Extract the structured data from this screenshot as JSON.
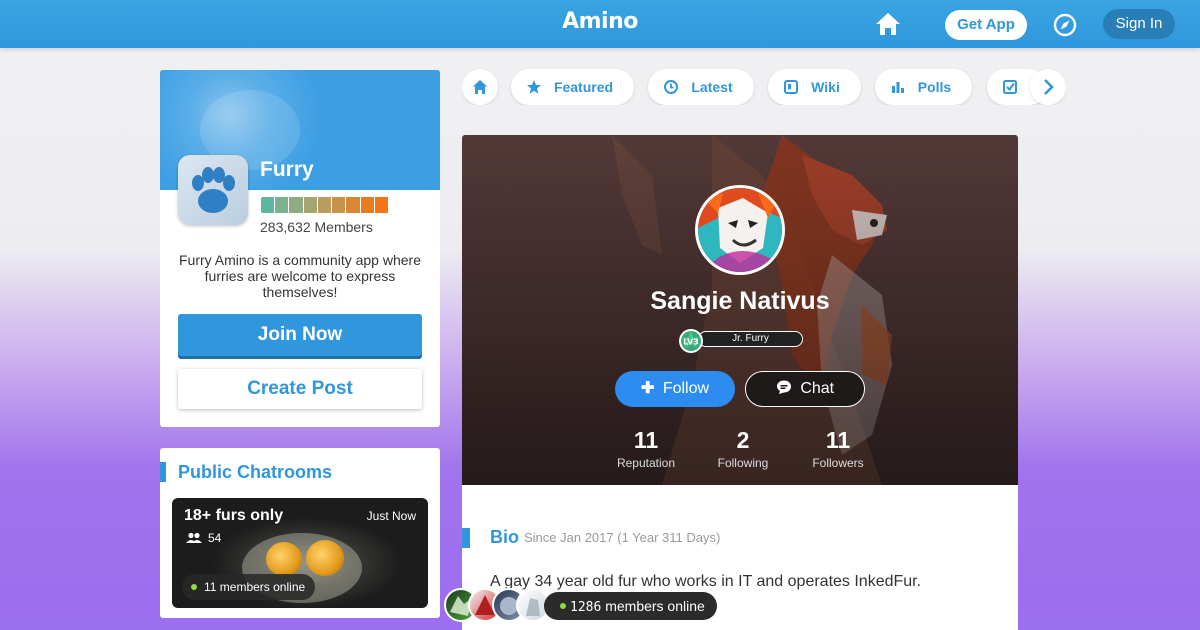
{
  "header": {
    "logo_text": "Amino",
    "get_app": "Get App",
    "sign_in": "Sign In",
    "icons": [
      "home-icon",
      "compass-icon"
    ],
    "accent": "#2f97dc"
  },
  "community": {
    "name": "Furry",
    "members": "283,632 Members",
    "description": "Furry Amino is a community app where furries are welcome to express themselves!",
    "join_label": "Join Now",
    "create_label": "Create Post",
    "level_colors": [
      "#5bb89e",
      "#7db08f",
      "#8fac81",
      "#a3a672",
      "#b89d5f",
      "#c8924a",
      "#d88832",
      "#e67e1f",
      "#f37516"
    ]
  },
  "chatrooms": {
    "title": "Public Chatrooms",
    "items": [
      {
        "name": "18+ furs only",
        "time": "Just Now",
        "count": "54",
        "online": "11 members online"
      }
    ]
  },
  "categories": {
    "items": [
      {
        "label": "Featured",
        "icon": "star-icon"
      },
      {
        "label": "Latest",
        "icon": "clock-icon"
      },
      {
        "label": "Wiki",
        "icon": "wiki-icon"
      },
      {
        "label": "Polls",
        "icon": "poll-icon"
      },
      {
        "label": "",
        "icon": "quiz-check-icon"
      }
    ]
  },
  "profile": {
    "name": "Sangie Nativus",
    "level": "LV3",
    "title": "Jr. Furry",
    "follow_label": "Follow",
    "chat_label": "Chat",
    "stats": [
      {
        "value": "11",
        "label": "Reputation"
      },
      {
        "value": "2",
        "label": "Following"
      },
      {
        "value": "11",
        "label": "Followers"
      }
    ],
    "bio_title": "Bio",
    "bio_since": "Since Jan 2017 (1 Year 311 Days)",
    "bio_text": "A gay 34 year old fur who works in IT and operates InkedFur."
  },
  "online": {
    "count": "1286",
    "suffix": " members online"
  }
}
